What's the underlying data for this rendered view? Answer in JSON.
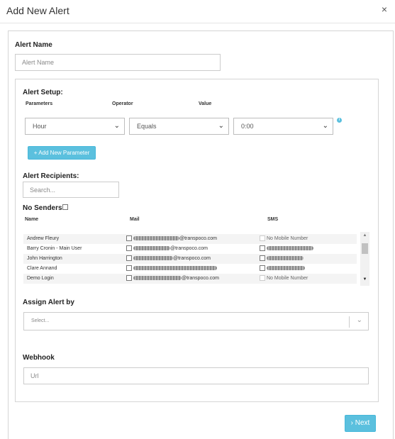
{
  "modal": {
    "title": "Add New Alert",
    "close": "×"
  },
  "alert_name": {
    "label": "Alert Name",
    "placeholder": "Alert Name"
  },
  "setup": {
    "label": "Alert Setup:",
    "col_parameters": "Parameters",
    "col_operator": "Operator",
    "col_value": "Value",
    "parameter": "Hour",
    "operator": "Equals",
    "value": "0:00",
    "add_button": "+ Add New Parameter"
  },
  "recipients": {
    "label": "Alert Recipients:",
    "search_placeholder": "Search...",
    "no_senders": "No Senders",
    "col_name": "Name",
    "col_mail": "Mail",
    "col_sms": "SMS",
    "rows": [
      {
        "name": "Andrew Fleury",
        "mail_suffix": "@transpoco.com",
        "sms": "No Mobile Number"
      },
      {
        "name": "Barry Cronin - Main User",
        "mail_suffix": "@transpoco.com",
        "sms": ""
      },
      {
        "name": "John Harrington",
        "mail_suffix": "@transpoco.com",
        "sms": ""
      },
      {
        "name": "Clare Annand",
        "mail_suffix": "",
        "sms": ""
      },
      {
        "name": "Demo Login",
        "mail_suffix": "@transpoco.com",
        "sms": "No Mobile Number"
      }
    ]
  },
  "assign": {
    "label": "Assign Alert by",
    "placeholder": "Select..."
  },
  "webhook": {
    "label": "Webhook",
    "placeholder": "Url"
  },
  "next_button": "› Next",
  "colors": {
    "accent": "#5bc0de",
    "border": "#d5d5d5"
  }
}
